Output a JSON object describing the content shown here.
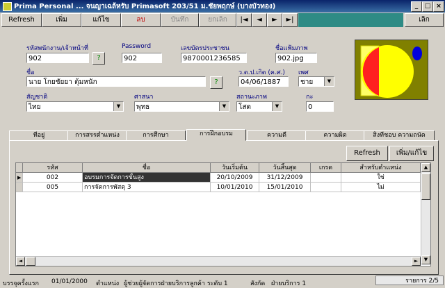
{
  "window": {
    "title": "Prima Personal ... จนญาเฉล้หรับ  Primasoft  203/51 ม.ชัยพฤกษ์ (บางบัวทอง)"
  },
  "toolbar": {
    "refresh": "Refresh",
    "add": "เพิ่ม",
    "edit": "แก้ไข",
    "delete": "ลบ",
    "save": "บันทึก",
    "cancel_edit": "ยกเลิก",
    "exit": "เลิก",
    "nav_first": "|◄",
    "nav_prev": "◄",
    "nav_next": "►",
    "nav_last": "►|"
  },
  "form": {
    "emp_id_label": "รหัสพนักงาน/เจ้าหน้าที่",
    "emp_id": "902",
    "password_label": "Password",
    "password": "902",
    "id_card_label": "เลขบัตรประชาชน",
    "id_card": "9870001236585",
    "photo_file_label": "ชื่อแฟ้มภาพ",
    "photo_file": "902.jpg",
    "name_label": "ชื่อ",
    "name": "นาย โกยชัยยา ตุ้มหนัก",
    "dob_label": "ว.ด.ป.เกิด (ค.ศ.)",
    "dob": "04/06/1887",
    "gender_label": "เพศ",
    "gender": "ชาย",
    "nationality_label": "สัญชาติ",
    "nationality": "ไทย",
    "religion_label": "ศาสนา",
    "religion": "พุทธ",
    "marital_label": "สถานะภาพ",
    "marital": "โสด",
    "children_label": "กะ",
    "children": "0",
    "help_glyph": "?"
  },
  "tabs": [
    {
      "label": "ที่อยู่"
    },
    {
      "label": "การสรรตำแหน่ง"
    },
    {
      "label": "การศึกษา"
    },
    {
      "label": "การฝึกอบรม"
    },
    {
      "label": "ความดี"
    },
    {
      "label": "ความผิด"
    },
    {
      "label": "สิ่งที่ชอบ ความถนัด"
    }
  ],
  "tab_panel": {
    "refresh": "Refresh",
    "add_edit": "เพิ่ม/แก้ไข"
  },
  "grid": {
    "headers": [
      "รหัส",
      "ชื่อ",
      "วันเริ่มต้น",
      "วันสิ้นสุด",
      "เกรด",
      "สำหรับตำแหน่ง"
    ],
    "rows": [
      {
        "code": "002",
        "name": "อบรมการจัดการขั้นสูง",
        "start": "20/10/2009",
        "end": "31/12/2009",
        "grade": "",
        "position": "ใช่"
      },
      {
        "code": "005",
        "name": "การจัดการพัสดุ 3",
        "start": "10/01/2010",
        "end": "15/01/2010",
        "grade": "",
        "position": "ไม่"
      }
    ]
  },
  "status": {
    "first_record_label": "บรรจุครั้งแรก",
    "first_record": "01/01/2000",
    "position_label": "ตำแหน่ง",
    "position": "ผู้ช่วยผู้จัดการฝ่ายบริการลูกค้า ระดับ 1",
    "dept_label": "สังกัด",
    "dept": "ฝ่ายบริการ 1",
    "record_label": "รายการ",
    "record": "2/5"
  },
  "colors": {
    "title_bar": "#0a246a",
    "label_text": "#000080",
    "toolbar_fill": "#2e8b85",
    "photo_bg": "#808000"
  }
}
